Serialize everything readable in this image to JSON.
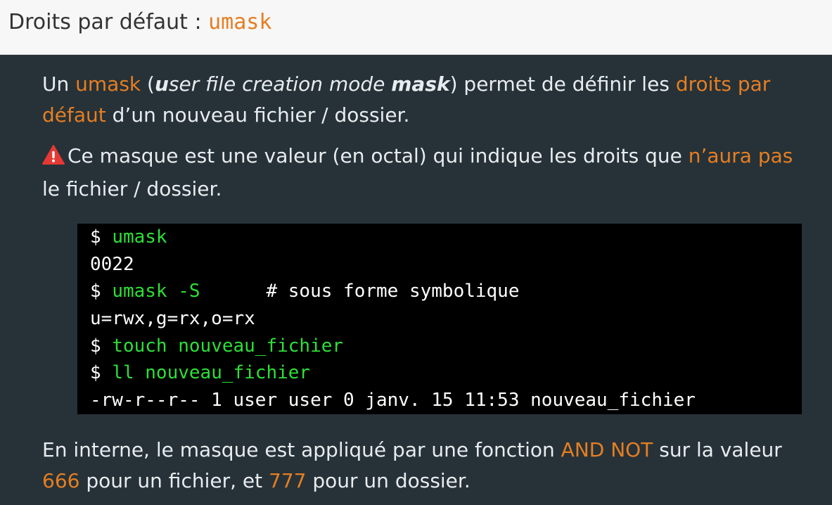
{
  "header": {
    "title_text": "Droits par défaut : ",
    "title_code": "umask"
  },
  "intro": {
    "t1": "Un ",
    "h1": "umask",
    "t2": " (",
    "i1": "u",
    "i2": "ser file creation mode ",
    "i3": "mask",
    "t3": ") permet de définir les ",
    "h2": "droits par défaut",
    "t4": " d’un nouveau fichier / dossier."
  },
  "warning": {
    "icon": "warning-icon",
    "t1": "Ce masque est une valeur (en octal) qui indique les droits que ",
    "h1": "n’aura pas",
    "t2": " le fichier / dossier."
  },
  "terminal": {
    "lines": [
      {
        "prompt": "$ ",
        "cmd": "umask",
        "rest": ""
      },
      {
        "prompt": "",
        "cmd": "",
        "rest": "0022"
      },
      {
        "prompt": "$ ",
        "cmd": "umask -S",
        "rest": "      # sous forme symbolique"
      },
      {
        "prompt": "",
        "cmd": "",
        "rest": "u=rwx,g=rx,o=rx"
      },
      {
        "prompt": "$ ",
        "cmd": "touch nouveau_fichier",
        "rest": ""
      },
      {
        "prompt": "$ ",
        "cmd": "ll nouveau_fichier",
        "rest": ""
      },
      {
        "prompt": "",
        "cmd": "",
        "rest": "-rw-r--r-- 1 user user 0 janv. 15 11:53 nouveau_fichier"
      }
    ]
  },
  "outro": {
    "t1": "En interne, le masque est appliqué par une fonction ",
    "h1": "AND NOT",
    "t2": " sur la valeur ",
    "h2": "666",
    "t3": " pour un fichier, et ",
    "h3": "777",
    "t4": " pour un dossier."
  },
  "colors": {
    "accent": "#e67e22",
    "background": "#263238",
    "terminal_bg": "#000000",
    "command": "#2ddf37",
    "warning": "#e53935"
  }
}
